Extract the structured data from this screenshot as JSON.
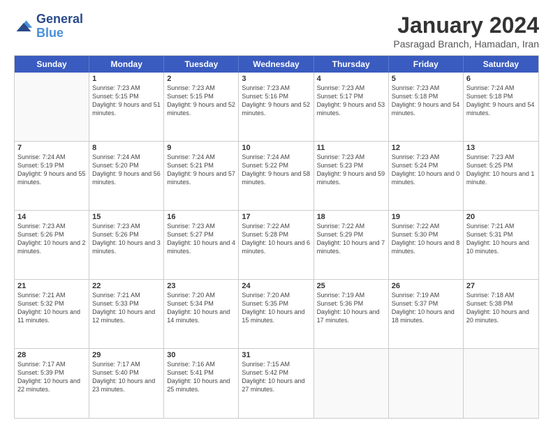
{
  "logo": {
    "line1": "General",
    "line2": "Blue"
  },
  "title": "January 2024",
  "subtitle": "Pasragad Branch, Hamadan, Iran",
  "header_days": [
    "Sunday",
    "Monday",
    "Tuesday",
    "Wednesday",
    "Thursday",
    "Friday",
    "Saturday"
  ],
  "weeks": [
    [
      {
        "day": "",
        "empty": true
      },
      {
        "day": "1",
        "sunrise": "Sunrise: 7:23 AM",
        "sunset": "Sunset: 5:15 PM",
        "daylight": "Daylight: 9 hours and 51 minutes."
      },
      {
        "day": "2",
        "sunrise": "Sunrise: 7:23 AM",
        "sunset": "Sunset: 5:15 PM",
        "daylight": "Daylight: 9 hours and 52 minutes."
      },
      {
        "day": "3",
        "sunrise": "Sunrise: 7:23 AM",
        "sunset": "Sunset: 5:16 PM",
        "daylight": "Daylight: 9 hours and 52 minutes."
      },
      {
        "day": "4",
        "sunrise": "Sunrise: 7:23 AM",
        "sunset": "Sunset: 5:17 PM",
        "daylight": "Daylight: 9 hours and 53 minutes."
      },
      {
        "day": "5",
        "sunrise": "Sunrise: 7:23 AM",
        "sunset": "Sunset: 5:18 PM",
        "daylight": "Daylight: 9 hours and 54 minutes."
      },
      {
        "day": "6",
        "sunrise": "Sunrise: 7:24 AM",
        "sunset": "Sunset: 5:18 PM",
        "daylight": "Daylight: 9 hours and 54 minutes."
      }
    ],
    [
      {
        "day": "7",
        "sunrise": "Sunrise: 7:24 AM",
        "sunset": "Sunset: 5:19 PM",
        "daylight": "Daylight: 9 hours and 55 minutes."
      },
      {
        "day": "8",
        "sunrise": "Sunrise: 7:24 AM",
        "sunset": "Sunset: 5:20 PM",
        "daylight": "Daylight: 9 hours and 56 minutes."
      },
      {
        "day": "9",
        "sunrise": "Sunrise: 7:24 AM",
        "sunset": "Sunset: 5:21 PM",
        "daylight": "Daylight: 9 hours and 57 minutes."
      },
      {
        "day": "10",
        "sunrise": "Sunrise: 7:24 AM",
        "sunset": "Sunset: 5:22 PM",
        "daylight": "Daylight: 9 hours and 58 minutes."
      },
      {
        "day": "11",
        "sunrise": "Sunrise: 7:23 AM",
        "sunset": "Sunset: 5:23 PM",
        "daylight": "Daylight: 9 hours and 59 minutes."
      },
      {
        "day": "12",
        "sunrise": "Sunrise: 7:23 AM",
        "sunset": "Sunset: 5:24 PM",
        "daylight": "Daylight: 10 hours and 0 minutes."
      },
      {
        "day": "13",
        "sunrise": "Sunrise: 7:23 AM",
        "sunset": "Sunset: 5:25 PM",
        "daylight": "Daylight: 10 hours and 1 minute."
      }
    ],
    [
      {
        "day": "14",
        "sunrise": "Sunrise: 7:23 AM",
        "sunset": "Sunset: 5:26 PM",
        "daylight": "Daylight: 10 hours and 2 minutes."
      },
      {
        "day": "15",
        "sunrise": "Sunrise: 7:23 AM",
        "sunset": "Sunset: 5:26 PM",
        "daylight": "Daylight: 10 hours and 3 minutes."
      },
      {
        "day": "16",
        "sunrise": "Sunrise: 7:23 AM",
        "sunset": "Sunset: 5:27 PM",
        "daylight": "Daylight: 10 hours and 4 minutes."
      },
      {
        "day": "17",
        "sunrise": "Sunrise: 7:22 AM",
        "sunset": "Sunset: 5:28 PM",
        "daylight": "Daylight: 10 hours and 6 minutes."
      },
      {
        "day": "18",
        "sunrise": "Sunrise: 7:22 AM",
        "sunset": "Sunset: 5:29 PM",
        "daylight": "Daylight: 10 hours and 7 minutes."
      },
      {
        "day": "19",
        "sunrise": "Sunrise: 7:22 AM",
        "sunset": "Sunset: 5:30 PM",
        "daylight": "Daylight: 10 hours and 8 minutes."
      },
      {
        "day": "20",
        "sunrise": "Sunrise: 7:21 AM",
        "sunset": "Sunset: 5:31 PM",
        "daylight": "Daylight: 10 hours and 10 minutes."
      }
    ],
    [
      {
        "day": "21",
        "sunrise": "Sunrise: 7:21 AM",
        "sunset": "Sunset: 5:32 PM",
        "daylight": "Daylight: 10 hours and 11 minutes."
      },
      {
        "day": "22",
        "sunrise": "Sunrise: 7:21 AM",
        "sunset": "Sunset: 5:33 PM",
        "daylight": "Daylight: 10 hours and 12 minutes."
      },
      {
        "day": "23",
        "sunrise": "Sunrise: 7:20 AM",
        "sunset": "Sunset: 5:34 PM",
        "daylight": "Daylight: 10 hours and 14 minutes."
      },
      {
        "day": "24",
        "sunrise": "Sunrise: 7:20 AM",
        "sunset": "Sunset: 5:35 PM",
        "daylight": "Daylight: 10 hours and 15 minutes."
      },
      {
        "day": "25",
        "sunrise": "Sunrise: 7:19 AM",
        "sunset": "Sunset: 5:36 PM",
        "daylight": "Daylight: 10 hours and 17 minutes."
      },
      {
        "day": "26",
        "sunrise": "Sunrise: 7:19 AM",
        "sunset": "Sunset: 5:37 PM",
        "daylight": "Daylight: 10 hours and 18 minutes."
      },
      {
        "day": "27",
        "sunrise": "Sunrise: 7:18 AM",
        "sunset": "Sunset: 5:38 PM",
        "daylight": "Daylight: 10 hours and 20 minutes."
      }
    ],
    [
      {
        "day": "28",
        "sunrise": "Sunrise: 7:17 AM",
        "sunset": "Sunset: 5:39 PM",
        "daylight": "Daylight: 10 hours and 22 minutes."
      },
      {
        "day": "29",
        "sunrise": "Sunrise: 7:17 AM",
        "sunset": "Sunset: 5:40 PM",
        "daylight": "Daylight: 10 hours and 23 minutes."
      },
      {
        "day": "30",
        "sunrise": "Sunrise: 7:16 AM",
        "sunset": "Sunset: 5:41 PM",
        "daylight": "Daylight: 10 hours and 25 minutes."
      },
      {
        "day": "31",
        "sunrise": "Sunrise: 7:15 AM",
        "sunset": "Sunset: 5:42 PM",
        "daylight": "Daylight: 10 hours and 27 minutes."
      },
      {
        "day": "",
        "empty": true
      },
      {
        "day": "",
        "empty": true
      },
      {
        "day": "",
        "empty": true
      }
    ]
  ]
}
